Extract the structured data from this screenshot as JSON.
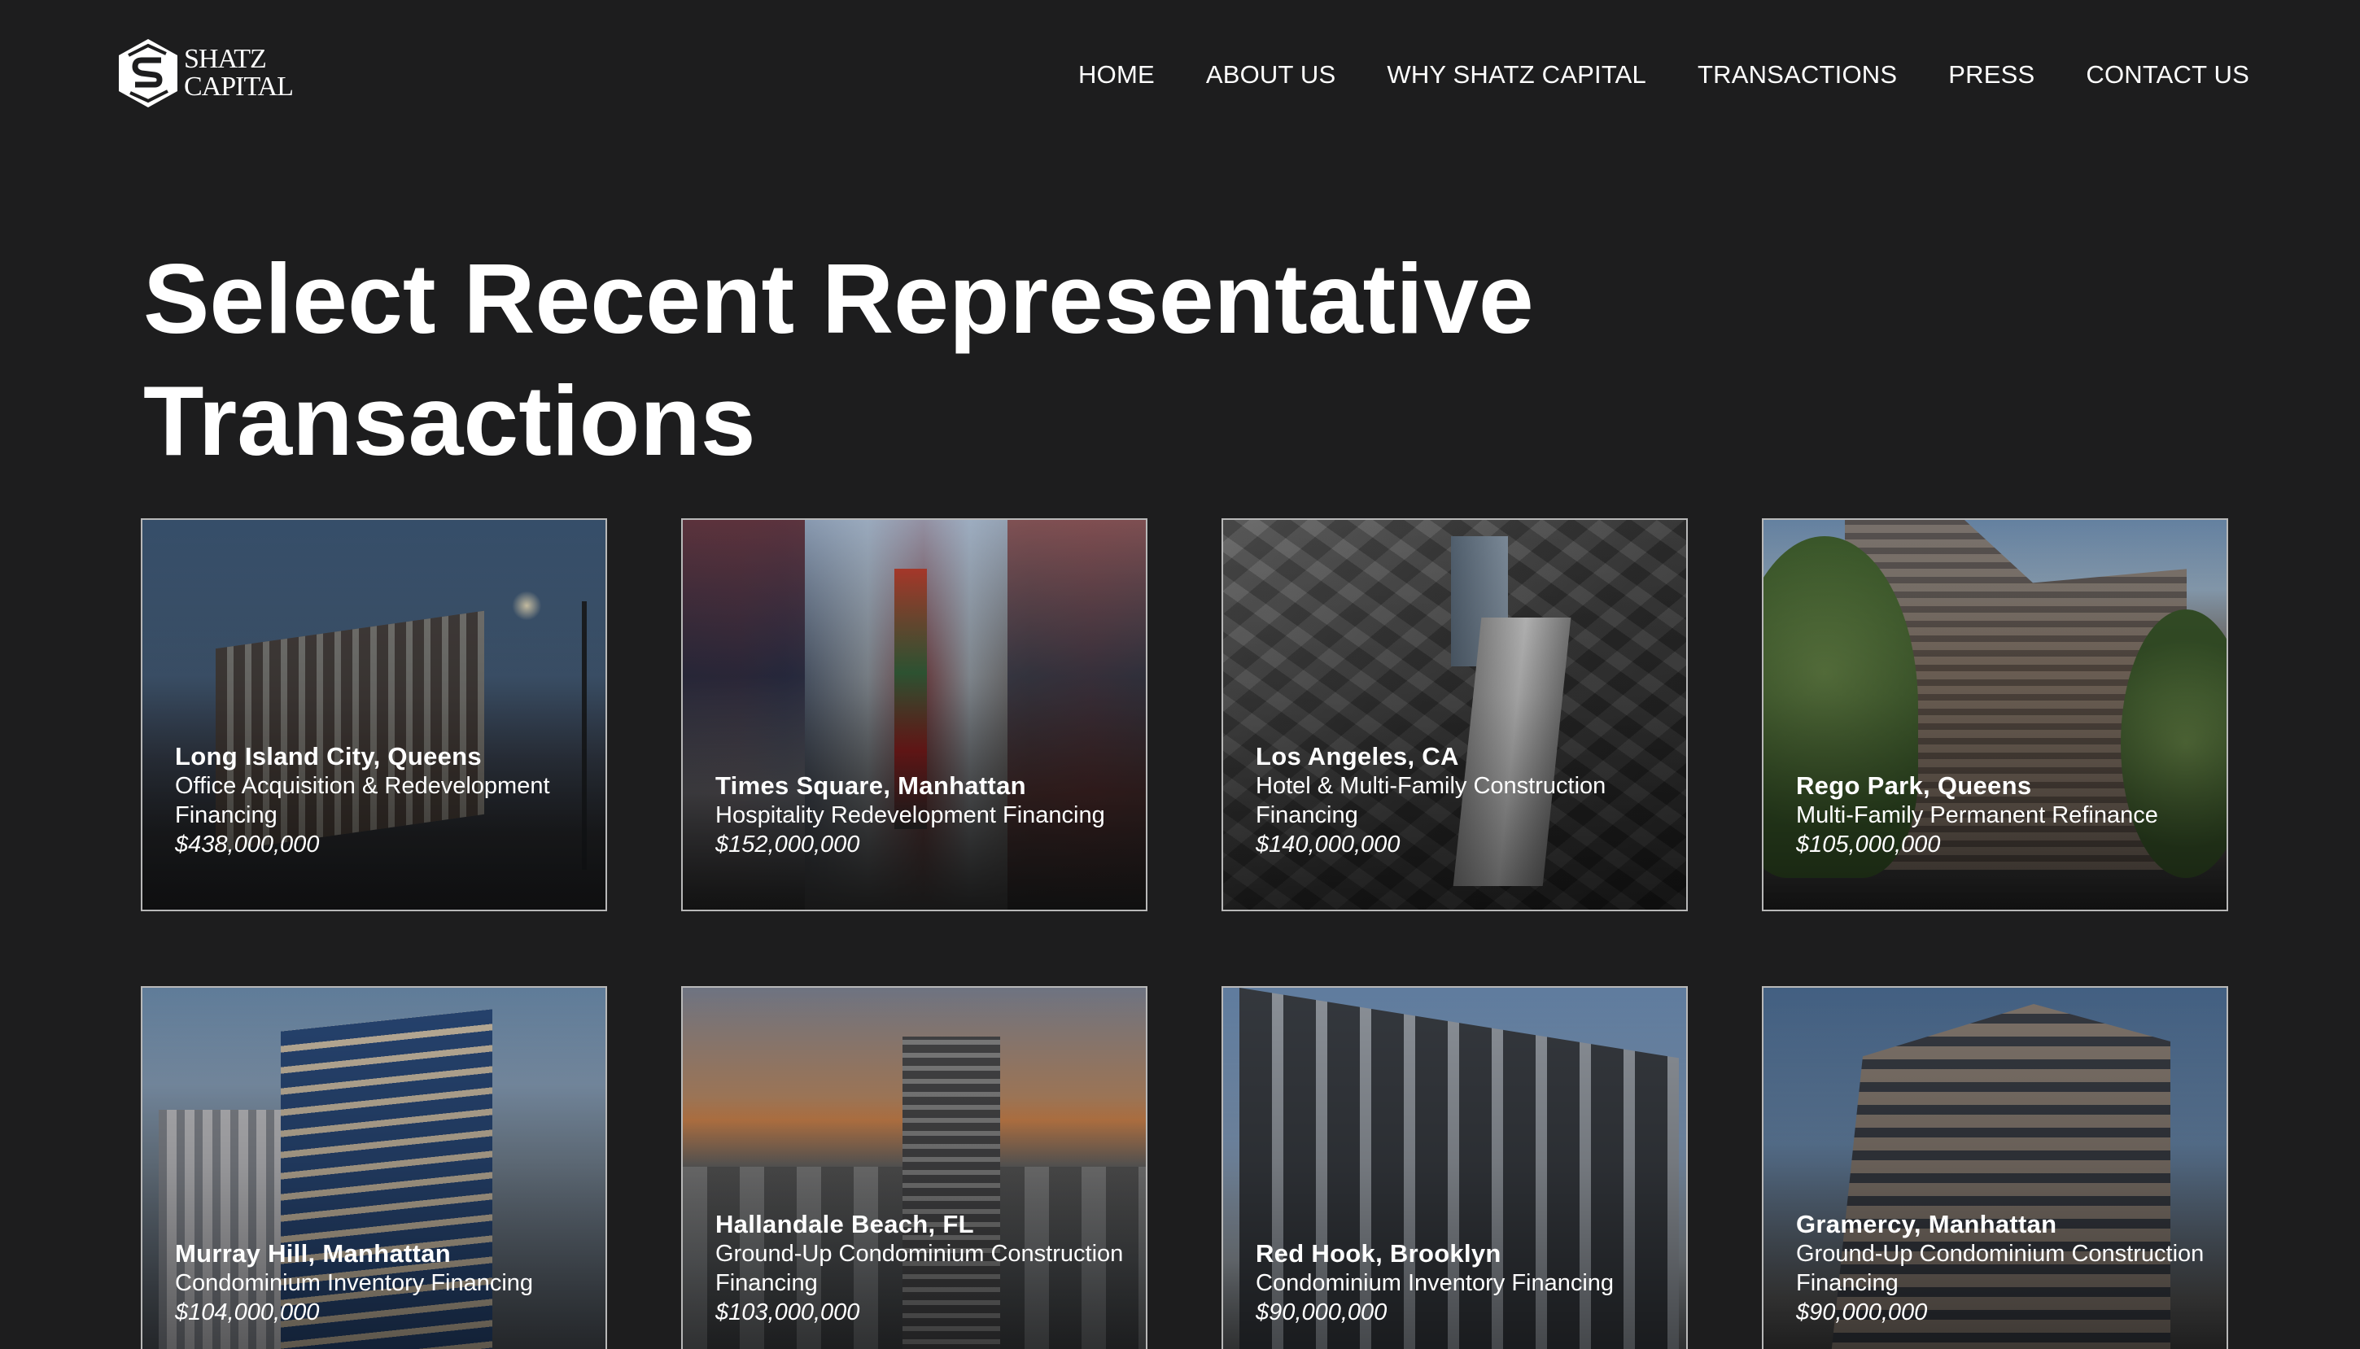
{
  "brand": {
    "name_line1": "SHATZ",
    "name_line2": "CAPITAL"
  },
  "nav": {
    "items": [
      {
        "label": "HOME"
      },
      {
        "label": "ABOUT US"
      },
      {
        "label": "WHY SHATZ CAPITAL"
      },
      {
        "label": "TRANSACTIONS"
      },
      {
        "label": "PRESS"
      },
      {
        "label": "CONTACT US"
      }
    ]
  },
  "page": {
    "title_line1": "Select Recent Representative",
    "title_line2": "Transactions"
  },
  "transactions": [
    {
      "location": "Long Island City, Queens",
      "type": "Office Acquisition & Redevelopment Financing",
      "amount": "$438,000,000"
    },
    {
      "location": "Times Square, Manhattan",
      "type": "Hospitality Redevelopment Financing",
      "amount": "$152,000,000"
    },
    {
      "location": "Los Angeles, CA",
      "type": "Hotel & Multi-Family Construction Financing",
      "amount": "$140,000,000"
    },
    {
      "location": "Rego Park, Queens",
      "type": "Multi-Family Permanent Refinance",
      "amount": "$105,000,000"
    },
    {
      "location": "Murray Hill, Manhattan",
      "type": "Condominium Inventory Financing",
      "amount": "$104,000,000"
    },
    {
      "location": "Hallandale Beach, FL",
      "type": "Ground-Up Condominium Construction Financing",
      "amount": "$103,000,000"
    },
    {
      "location": "Red Hook, Brooklyn",
      "type": "Condominium Inventory Financing",
      "amount": "$90,000,000"
    },
    {
      "location": "Gramercy, Manhattan",
      "type": "Ground-Up Condominium Construction Financing",
      "amount": "$90,000,000"
    }
  ],
  "colors": {
    "background": "#1d1d1e",
    "text": "#ffffff",
    "card_border": "#b8b8b8"
  }
}
